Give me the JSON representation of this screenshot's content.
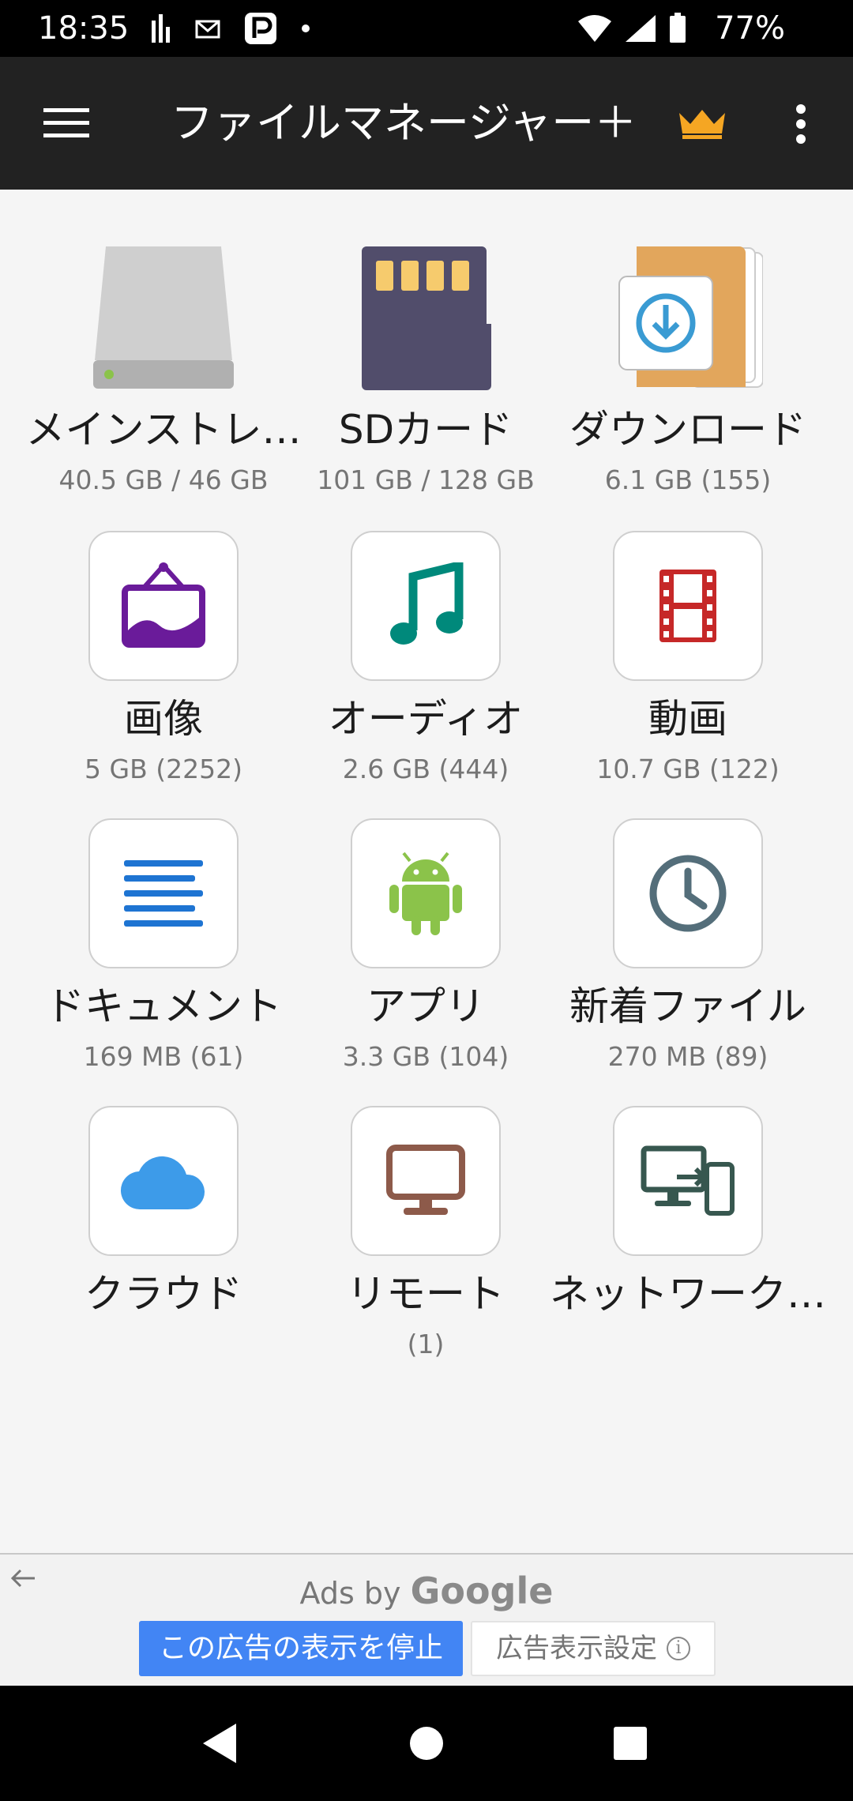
{
  "status_bar": {
    "time": "18:35",
    "battery_percent": "77%"
  },
  "app_bar": {
    "title": "ファイルマネージャー＋",
    "menu_icon": "hamburger-icon",
    "premium_icon": "crown-icon",
    "overflow_icon": "more-vert-icon"
  },
  "tiles": [
    {
      "label": "メインストレ…",
      "sub": "40.5 GB / 46 GB",
      "icon": "internal-storage-icon"
    },
    {
      "label": "SDカード",
      "sub": "101 GB / 128 GB",
      "icon": "sd-card-icon"
    },
    {
      "label": "ダウンロード",
      "sub": "6.1 GB (155)",
      "icon": "download-folder-icon"
    },
    {
      "label": "画像",
      "sub": "5 GB (2252)",
      "icon": "image-icon"
    },
    {
      "label": "オーディオ",
      "sub": "2.6 GB (444)",
      "icon": "music-note-icon"
    },
    {
      "label": "動画",
      "sub": "10.7 GB (122)",
      "icon": "film-icon"
    },
    {
      "label": "ドキュメント",
      "sub": "169 MB (61)",
      "icon": "document-icon"
    },
    {
      "label": "アプリ",
      "sub": "3.3 GB (104)",
      "icon": "android-icon"
    },
    {
      "label": "新着ファイル",
      "sub": "270 MB (89)",
      "icon": "clock-icon"
    },
    {
      "label": "クラウド",
      "sub": "",
      "icon": "cloud-icon"
    },
    {
      "label": "リモート",
      "sub": "(1)",
      "icon": "monitor-icon"
    },
    {
      "label": "ネットワーク…",
      "sub": "",
      "icon": "network-devices-icon"
    }
  ],
  "ads": {
    "ads_by": "Ads by",
    "google": "Google",
    "stop_label": "この広告の表示を停止",
    "settings_label": "広告表示設定"
  },
  "colors": {
    "app_bar": "#222222",
    "crown": "#f5a623",
    "image_icon": "#6a1b9a",
    "audio_icon": "#00897b",
    "video_icon": "#c62828",
    "document_icon": "#1e74d2",
    "android_icon": "#8bc34a",
    "clock_icon": "#546e7a",
    "cloud_icon": "#3d9be9",
    "remote_icon": "#8d5a4a",
    "network_icon": "#37574f",
    "ad_button": "#4285f4"
  }
}
